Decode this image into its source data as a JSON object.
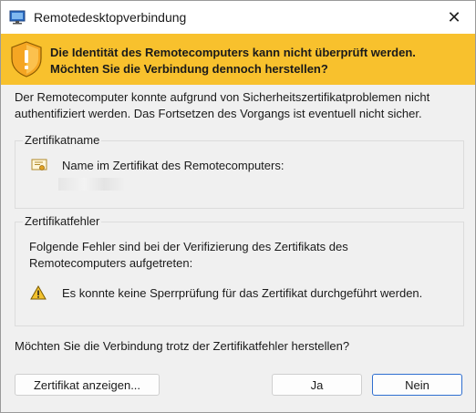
{
  "window": {
    "title": "Remotedesktopverbindung"
  },
  "banner": {
    "line1": "Die Identität des Remotecomputers kann nicht überprüft werden.",
    "line2": "Möchten Sie die Verbindung dennoch herstellen?"
  },
  "description": {
    "line1": "Der Remotecomputer konnte aufgrund von Sicherheitszertifikatproblemen nicht",
    "line2": "authentifiziert werden. Das Fortsetzen des Vorgangs ist eventuell nicht sicher."
  },
  "certificate_name": {
    "title": "Zertifikatname",
    "label": "Name im Zertifikat des Remotecomputers:"
  },
  "certificate_errors": {
    "title": "Zertifikatfehler",
    "intro_line1": "Folgende Fehler sind bei der Verifizierung des Zertifikats des",
    "intro_line2": "Remotecomputers aufgetreten:",
    "error": "Es konnte keine Sperrprüfung für das Zertifikat durchgeführt werden."
  },
  "question": "Möchten Sie die Verbindung trotz der Zertifikatfehler herstellen?",
  "buttons": {
    "view_cert": "Zertifikat anzeigen...",
    "yes": "Ja",
    "no": "Nein"
  },
  "colors": {
    "banner": "#f8c12d",
    "default_button_border": "#2f6fd0"
  },
  "icons": {
    "app": "remote-desktop-icon",
    "banner": "warning-shield-icon",
    "cert": "certificate-icon",
    "error": "warning-triangle-icon"
  }
}
